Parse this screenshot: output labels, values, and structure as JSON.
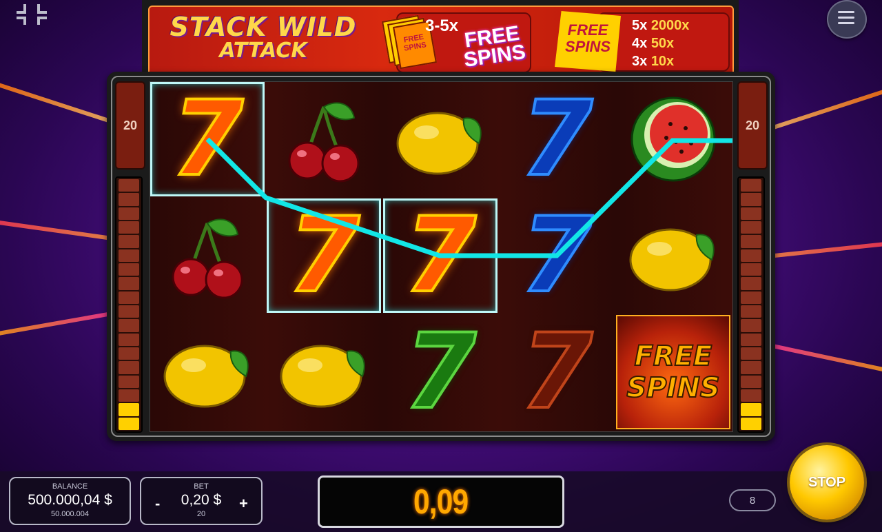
{
  "game": {
    "title_line1": "STACK WILD",
    "title_line2": "ATTACK"
  },
  "banner": {
    "promo1_multiplier": "3-5x",
    "promo1_text": "FREE SPINS",
    "promo1_card_text": "FREE SPINS",
    "promo2_badge": "FREE SPINS",
    "paytable": [
      {
        "count": "5x",
        "value": "2000x"
      },
      {
        "count": "4x",
        "value": "50x"
      },
      {
        "count": "3x",
        "value": "10x"
      }
    ]
  },
  "lines_left": "20",
  "lines_right": "20",
  "reels": {
    "symbols": [
      [
        "seven-orange",
        "cherry",
        "lemon",
        "seven-blue",
        "watermelon"
      ],
      [
        "cherry",
        "seven-orange",
        "seven-orange",
        "seven-blue",
        "lemon"
      ],
      [
        "lemon",
        "lemon",
        "seven-green",
        "seven-darkred",
        "free-spins"
      ]
    ],
    "winning_cells": [
      [
        0,
        0
      ],
      [
        1,
        1
      ],
      [
        1,
        2
      ]
    ],
    "free_spins_text": "FREE SPINS"
  },
  "balance": {
    "label": "BALANCE",
    "value": "500.000,04 $",
    "credits": "50.000.004"
  },
  "bet": {
    "label": "BET",
    "minus": "-",
    "value": "0,20 $",
    "plus": "+",
    "lines": "20"
  },
  "win": {
    "value": "0,09"
  },
  "autoplay": {
    "count": "8"
  },
  "spin_button": {
    "label": "STOP"
  },
  "colors": {
    "win_text": "#ffa800",
    "payline": "#12e6e6",
    "accent": "#ffd000"
  },
  "meter": {
    "segments": 18,
    "lit": 2
  }
}
